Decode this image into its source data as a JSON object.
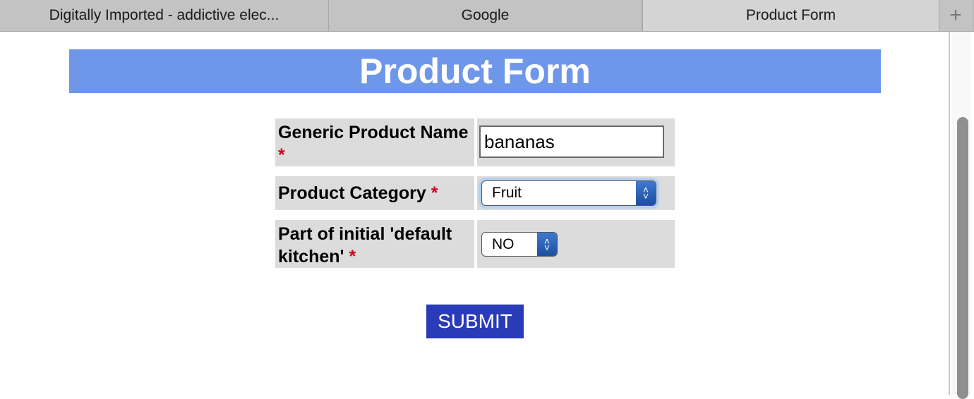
{
  "browser": {
    "tabs": [
      {
        "label": "Digitally Imported - addictive elec..."
      },
      {
        "label": "Google"
      },
      {
        "label": "Product Form",
        "active": true
      }
    ],
    "new_tab_icon": "plus-icon"
  },
  "page": {
    "title": "Product Form",
    "header_color": "#6e97ea",
    "required_marker": "*",
    "fields": [
      {
        "label": "Generic Product Name",
        "type": "text",
        "value": "bananas"
      },
      {
        "label": "Product Category",
        "type": "select",
        "value": "Fruit"
      },
      {
        "label": "Part of initial 'default kitchen'",
        "type": "select",
        "value": "NO"
      }
    ],
    "submit_label": "SUBMIT",
    "submit_color": "#2a3bb7"
  }
}
